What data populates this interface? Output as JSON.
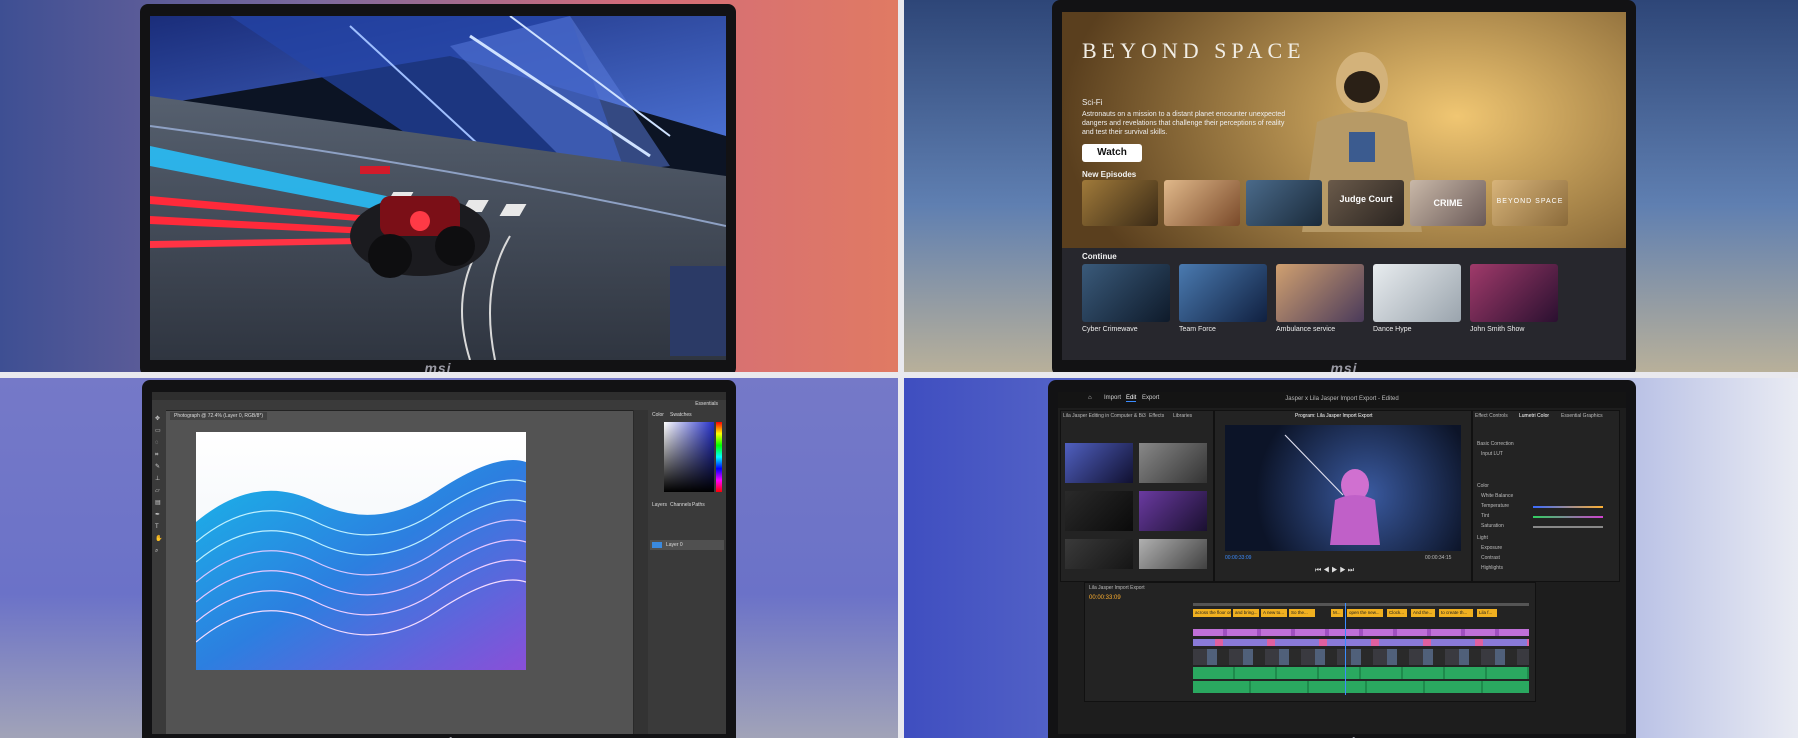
{
  "brand": "msi",
  "streaming": {
    "title": "BEYOND SPACE",
    "genre": "Sci-Fi",
    "description": "Astronauts on a mission to a distant planet encounter unexpected dangers and revelations that challenge their perceptions of reality and test their survival skills.",
    "watch_label": "Watch",
    "new_episodes_label": "New Episodes",
    "episode_tiles": [
      "",
      "",
      "",
      "Judge Court",
      "CRIME",
      "BEYOND SPACE"
    ],
    "continue_label": "Continue",
    "continue_items": [
      "Cyber Crimewave",
      "Team Force",
      "Ambulance service",
      "Dance Hype",
      "John Smith Show"
    ]
  },
  "photoshop": {
    "doc_tab": "Photograph @ 72.4% (Layer 0, RGB/8*)",
    "panel_tabs": [
      "Color",
      "Swatches"
    ],
    "layers_tabs": [
      "Layers",
      "Channels",
      "Paths"
    ],
    "layer_name": "Layer 0",
    "workspace": "Essentials"
  },
  "premiere": {
    "nav": [
      "Import",
      "Edit",
      "Export"
    ],
    "project_title": "Jasper x Lila Jasper Import Export - Edited",
    "source_tabs": [
      "Lila Jasper Editing in Computer & Bi3",
      "Effects",
      "Libraries"
    ],
    "program_tab": "Program: Lila Jasper Import Export",
    "effect_tabs": [
      "Effect Controls",
      "Lumetri Color",
      "Essential Graphics"
    ],
    "timecode_left": "00:00:33:09",
    "timecode_right": "00:00:34:15",
    "timeline_tab": "Lila Jasper Import Export",
    "timeline_timecode": "00:00:33:09",
    "lumetri": [
      "Basic Correction",
      "Input LUT",
      "Color",
      "White Balance",
      "Temperature",
      "Tint",
      "Saturation",
      "Light",
      "Exposure",
      "Contrast",
      "Highlights"
    ],
    "caption_clips": [
      "across the floor or...",
      "and bring...",
      "A new to...",
      "So the...",
      "M...",
      "open the new...",
      "Clock...",
      "And the...",
      "to create th...",
      "Lila f..."
    ]
  }
}
